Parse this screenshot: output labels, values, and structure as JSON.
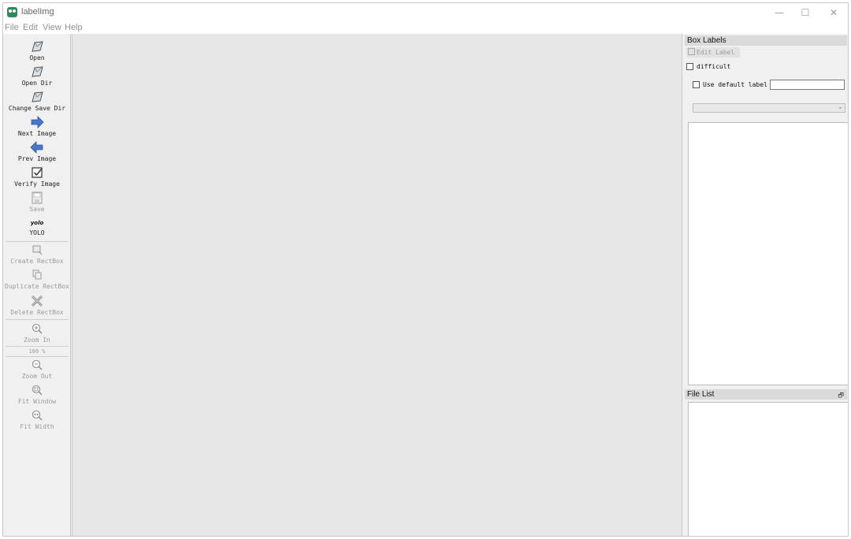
{
  "window": {
    "title": "labelImg",
    "controls": {
      "minimize": "—",
      "maximize": "☐",
      "close": "✕"
    }
  },
  "menu": {
    "items": [
      "File",
      "Edit",
      "View",
      "Help"
    ]
  },
  "toolbar": {
    "open": "Open",
    "open_dir": "Open Dir",
    "change_save_dir": "Change Save Dir",
    "next_image": "Next Image",
    "prev_image": "Prev Image",
    "verify_image": "Verify Image",
    "save": "Save",
    "yolo_icon_text": "yolo",
    "yolo": "YOLO",
    "create_rectbox": "Create RectBox",
    "duplicate_rectbox": "Duplicate RectBox",
    "delete_rectbox": "Delete RectBox",
    "zoom_in": "Zoom In",
    "zoom_value": "100 %",
    "zoom_out": "Zoom Out",
    "fit_window": "Fit Window",
    "fit_width": "Fit Width"
  },
  "box_labels": {
    "title": "Box Labels",
    "edit_label": "Edit Label",
    "difficult": "difficult",
    "use_default_label": "Use default label",
    "default_label_value": ""
  },
  "file_list": {
    "title": "File List"
  },
  "colors": {
    "accent_blue": "#4a76c8",
    "canvas_bg": "#e6e6e6",
    "icon_green": "#2e8a5a"
  }
}
